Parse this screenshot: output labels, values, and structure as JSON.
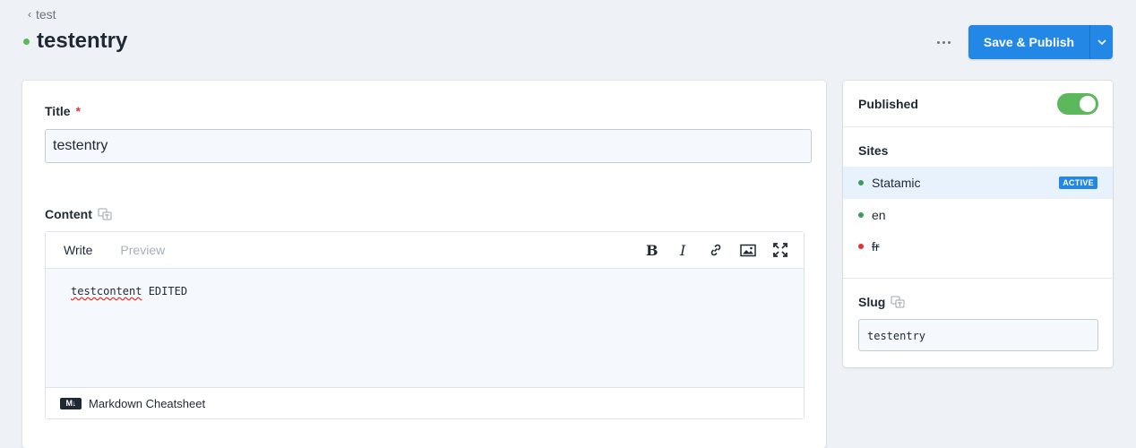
{
  "breadcrumb": {
    "label": "test"
  },
  "header": {
    "title": "testentry",
    "publish_label": "Save & Publish"
  },
  "colors": {
    "accent": "#2388e5",
    "published": "#5cb85c",
    "danger": "#e3342f"
  },
  "fields": {
    "title": {
      "label": "Title",
      "required_mark": "*",
      "value": "testentry"
    },
    "content": {
      "label": "Content",
      "tabs": [
        "Write",
        "Preview"
      ],
      "toolbar_icons": [
        "bold-icon",
        "italic-icon",
        "link-icon",
        "image-icon",
        "fullscreen-icon"
      ],
      "text_word": "testcontent",
      "text_rest": " EDITED",
      "footer_badge": "M↓",
      "footer_link": "Markdown Cheatsheet"
    }
  },
  "sidebar": {
    "published_label": "Published",
    "published": true,
    "sites_label": "Sites",
    "sites": [
      {
        "name": "Statamic",
        "status_color": "#3a9d5d",
        "active_badge": "ACTIVE"
      },
      {
        "name": "en",
        "status_color": "#3a9d5d"
      },
      {
        "name": "fr",
        "status_color": "#e3342f"
      }
    ],
    "slug_label": "Slug",
    "slug_value": "testentry"
  }
}
